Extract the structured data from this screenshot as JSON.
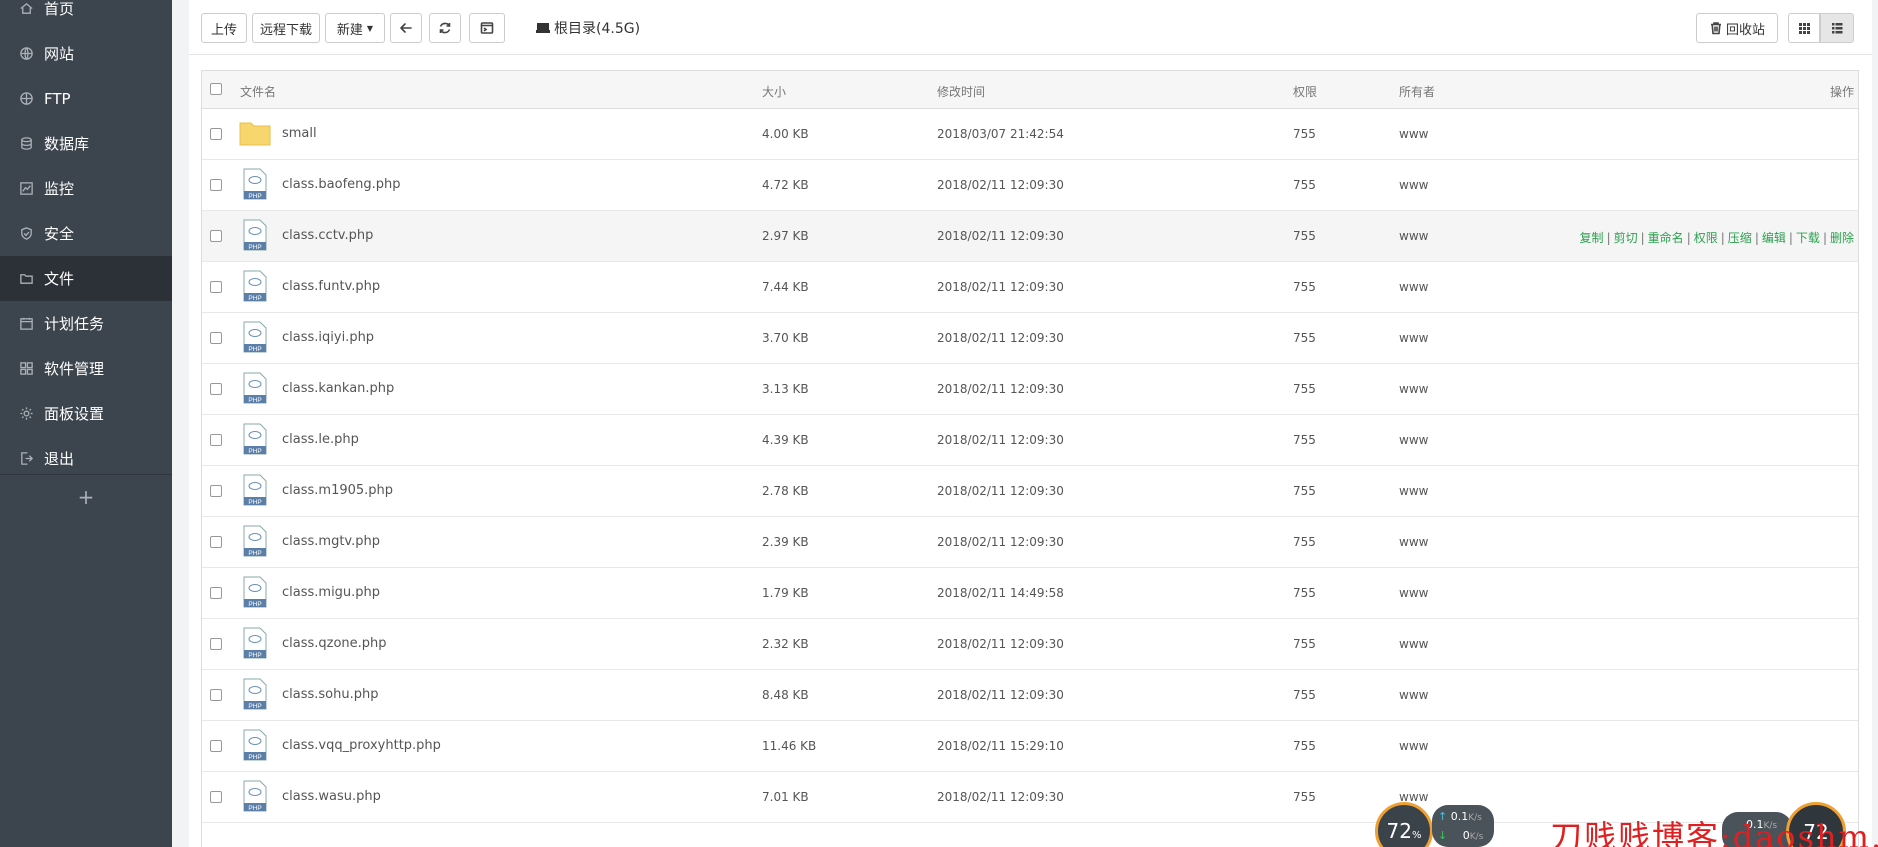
{
  "sidebar": {
    "items": [
      {
        "label": "首页",
        "icon": "home-icon"
      },
      {
        "label": "网站",
        "icon": "globe-icon"
      },
      {
        "label": "FTP",
        "icon": "ftp-icon"
      },
      {
        "label": "数据库",
        "icon": "database-icon"
      },
      {
        "label": "监控",
        "icon": "monitor-icon"
      },
      {
        "label": "安全",
        "icon": "shield-icon"
      },
      {
        "label": "文件",
        "icon": "folder-icon",
        "active": true
      },
      {
        "label": "计划任务",
        "icon": "calendar-icon"
      },
      {
        "label": "软件管理",
        "icon": "grid-icon"
      },
      {
        "label": "面板设置",
        "icon": "gear-icon"
      },
      {
        "label": "退出",
        "icon": "logout-icon"
      }
    ],
    "add_label": "+"
  },
  "toolbar": {
    "upload": "上传",
    "remote_download": "远程下载",
    "new": "新建",
    "path": "根目录(4.5G)",
    "recycle_bin": "回收站"
  },
  "table": {
    "headers": {
      "name": "文件名",
      "size": "大小",
      "mtime": "修改时间",
      "perm": "权限",
      "owner": "所有者",
      "ops": "操作"
    },
    "rows": [
      {
        "name": "small",
        "type": "folder",
        "size": "4.00 KB",
        "mtime": "2018/03/07 21:42:54",
        "perm": "755",
        "owner": "www"
      },
      {
        "name": "class.baofeng.php",
        "type": "php",
        "size": "4.72 KB",
        "mtime": "2018/02/11 12:09:30",
        "perm": "755",
        "owner": "www"
      },
      {
        "name": "class.cctv.php",
        "type": "php",
        "size": "2.97 KB",
        "mtime": "2018/02/11 12:09:30",
        "perm": "755",
        "owner": "www",
        "hover": true
      },
      {
        "name": "class.funtv.php",
        "type": "php",
        "size": "7.44 KB",
        "mtime": "2018/02/11 12:09:30",
        "perm": "755",
        "owner": "www"
      },
      {
        "name": "class.iqiyi.php",
        "type": "php",
        "size": "3.70 KB",
        "mtime": "2018/02/11 12:09:30",
        "perm": "755",
        "owner": "www"
      },
      {
        "name": "class.kankan.php",
        "type": "php",
        "size": "3.13 KB",
        "mtime": "2018/02/11 12:09:30",
        "perm": "755",
        "owner": "www"
      },
      {
        "name": "class.le.php",
        "type": "php",
        "size": "4.39 KB",
        "mtime": "2018/02/11 12:09:30",
        "perm": "755",
        "owner": "www"
      },
      {
        "name": "class.m1905.php",
        "type": "php",
        "size": "2.78 KB",
        "mtime": "2018/02/11 12:09:30",
        "perm": "755",
        "owner": "www"
      },
      {
        "name": "class.mgtv.php",
        "type": "php",
        "size": "2.39 KB",
        "mtime": "2018/02/11 12:09:30",
        "perm": "755",
        "owner": "www"
      },
      {
        "name": "class.migu.php",
        "type": "php",
        "size": "1.79 KB",
        "mtime": "2018/02/11 14:49:58",
        "perm": "755",
        "owner": "www"
      },
      {
        "name": "class.qzone.php",
        "type": "php",
        "size": "2.32 KB",
        "mtime": "2018/02/11 12:09:30",
        "perm": "755",
        "owner": "www"
      },
      {
        "name": "class.sohu.php",
        "type": "php",
        "size": "8.48 KB",
        "mtime": "2018/02/11 12:09:30",
        "perm": "755",
        "owner": "www"
      },
      {
        "name": "class.vqq_proxyhttp.php",
        "type": "php",
        "size": "11.46 KB",
        "mtime": "2018/02/11 15:29:10",
        "perm": "755",
        "owner": "www"
      },
      {
        "name": "class.wasu.php",
        "type": "php",
        "size": "7.01 KB",
        "mtime": "2018/02/11 12:09:30",
        "perm": "755",
        "owner": "www"
      }
    ],
    "row_actions": [
      "复制",
      "剪切",
      "重命名",
      "权限",
      "压缩",
      "编辑",
      "下载",
      "删除"
    ]
  },
  "widgets": {
    "gauge_value": "72",
    "gauge_unit": "%",
    "speed_up": "0.1",
    "speed_down": "0",
    "speed_unit": "K/s",
    "gauge2_value": "72",
    "speed2_up": "0.1",
    "speed2_unit": "K/s"
  },
  "watermark": "刀贱贱博客:daoshm.com",
  "colors": {
    "sidebar_bg": "#3c444d",
    "sidebar_active": "#2c3138",
    "action_green": "#2ea050",
    "watermark_red": "#e02020"
  }
}
